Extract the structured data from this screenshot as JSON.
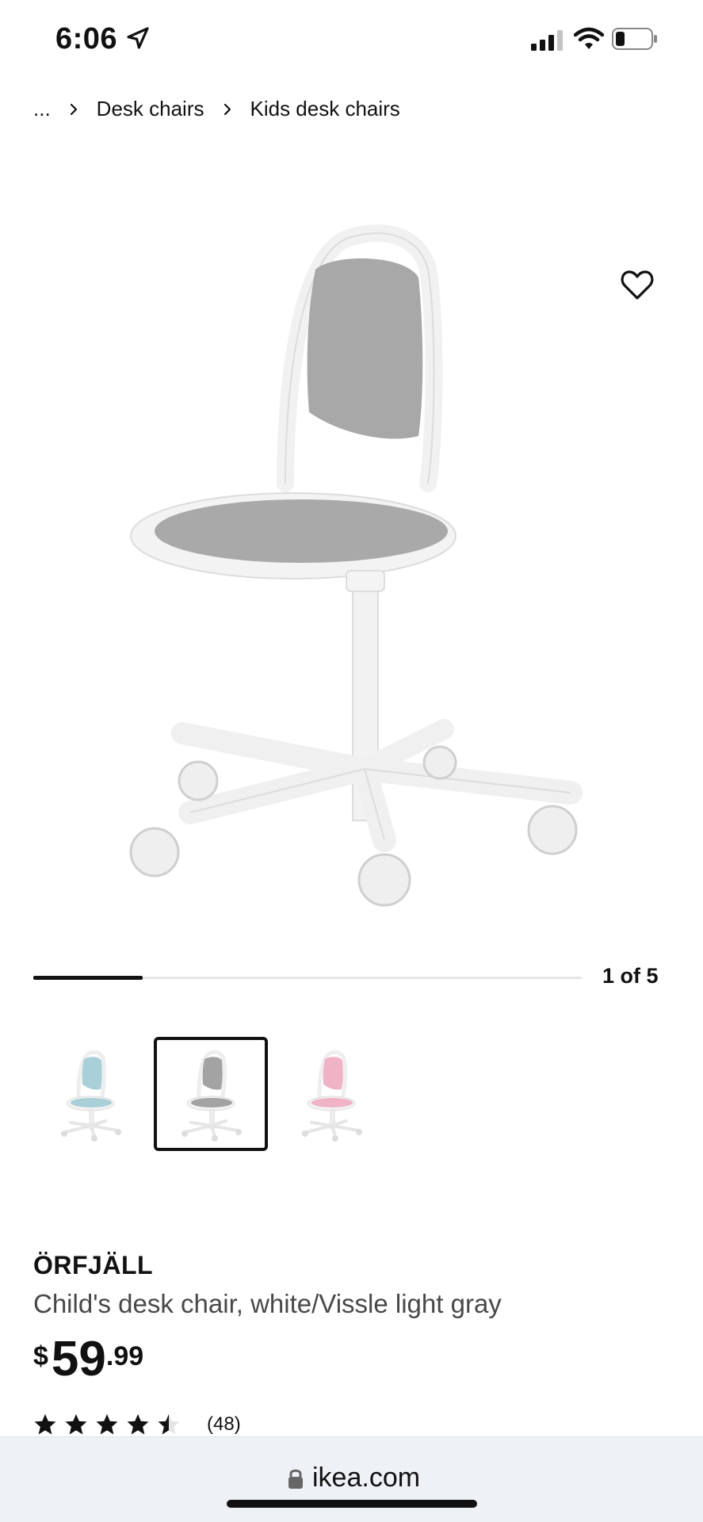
{
  "status_bar": {
    "time": "6:06",
    "icons": [
      "location-arrow-icon",
      "signal-icon",
      "wifi-icon",
      "battery-icon"
    ]
  },
  "breadcrumb": {
    "items": [
      "...",
      "Desk chairs",
      "Kids desk chairs"
    ]
  },
  "gallery": {
    "position_label": "1 of 5",
    "progress_fraction": 0.2,
    "thumbnails": [
      {
        "variant_color": "#a9cfd9",
        "selected": false
      },
      {
        "variant_color": "#a3a3a3",
        "selected": true
      },
      {
        "variant_color": "#f0b3c6",
        "selected": false
      }
    ]
  },
  "product": {
    "name": "ÖRFJÄLL",
    "description": "Child's desk chair, white/Vissle light gray",
    "price": {
      "currency": "$",
      "integer": "59",
      "decimal": ".99"
    },
    "rating": {
      "stars": 4.5,
      "count_label": "(48)"
    }
  },
  "browser": {
    "url": "ikea.com"
  },
  "colors": {
    "text": "#111111",
    "secondary_text": "#484848",
    "seat_fabric": "#a8a8a8",
    "frame": "#f4f4f4"
  }
}
